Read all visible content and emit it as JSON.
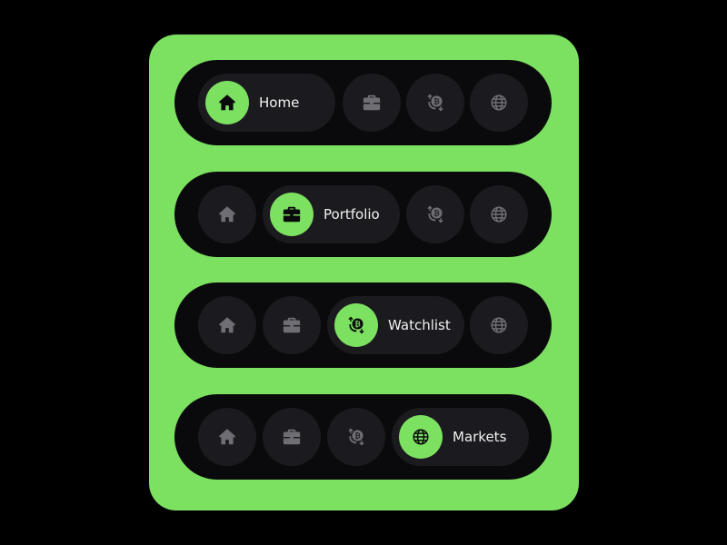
{
  "colors": {
    "background": "#000000",
    "card": "#7ce061",
    "navbar": "#0a0a0c",
    "inactive_item": "#1b1b1f",
    "accent": "#7ce061",
    "inactive_icon": "#6e6e74",
    "label_text": "#f2f2f2"
  },
  "nav_items": [
    {
      "key": "home",
      "label": "Home",
      "icon": "home-icon"
    },
    {
      "key": "portfolio",
      "label": "Portfolio",
      "icon": "briefcase-icon"
    },
    {
      "key": "watchlist",
      "label": "Watchlist",
      "icon": "bitcoin-exchange-icon"
    },
    {
      "key": "markets",
      "label": "Markets",
      "icon": "globe-icon"
    }
  ],
  "variants": [
    {
      "active": "home"
    },
    {
      "active": "portfolio"
    },
    {
      "active": "watchlist"
    },
    {
      "active": "markets"
    }
  ],
  "labels": {
    "home": "Home",
    "portfolio": "Portfolio",
    "watchlist": "Watchlist",
    "markets": "Markets"
  }
}
